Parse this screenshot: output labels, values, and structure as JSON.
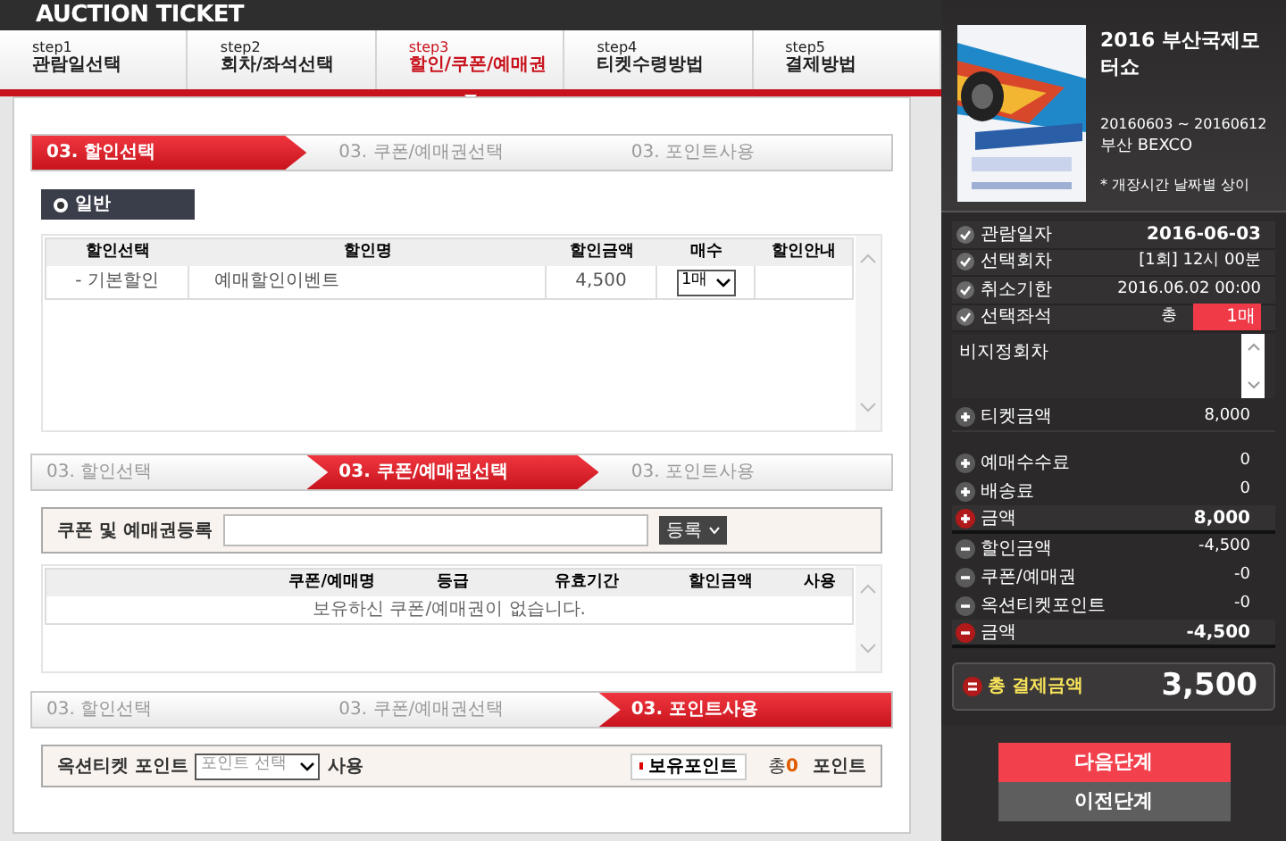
{
  "header": {
    "title": "AUCTION TICKET"
  },
  "steps": [
    {
      "step": "step1",
      "label": "관람일선택",
      "selected": false
    },
    {
      "step": "step2",
      "label": "회차/좌석선택",
      "selected": false
    },
    {
      "step": "step3",
      "label": "할인/쿠폰/예매권",
      "selected": true
    },
    {
      "step": "step4",
      "label": "티켓수령방법",
      "selected": false
    },
    {
      "step": "step5",
      "label": "결제방법",
      "selected": false
    }
  ],
  "discount_section": {
    "tabs": [
      {
        "label": "03. 할인선택",
        "selected": true
      },
      {
        "label": "03. 쿠폰/예매권선택",
        "selected": false
      },
      {
        "label": "03. 포인트사용",
        "selected": false
      }
    ],
    "radio": {
      "label": "일반",
      "selected": true
    },
    "table": {
      "columns": [
        "할인선택",
        "할인명",
        "할인금액",
        "매수",
        "할인안내"
      ],
      "rows": [
        {
          "type": "- 기본할인",
          "name": "예매할인이벤트",
          "amount": "4,500",
          "quantity": "1매"
        }
      ]
    }
  },
  "coupon_section": {
    "tabs": [
      {
        "label": "03. 할인선택",
        "selected": false
      },
      {
        "label": "03. 쿠폰/예매권선택",
        "selected": true
      },
      {
        "label": "03. 포인트사용",
        "selected": false
      }
    ],
    "field_label": "쿠폰 및 예매권등록",
    "register_button": "등록",
    "table": {
      "columns": [
        "쿠폰/예매명",
        "등급",
        "유효기간",
        "할인금액",
        "사용"
      ],
      "empty_message": "보유하신 쿠폰/예매권이 없습니다."
    }
  },
  "point_section": {
    "tabs": [
      {
        "label": "03. 할인선택",
        "selected": false
      },
      {
        "label": "03. 쿠폰/예매권선택",
        "selected": false
      },
      {
        "label": "03. 포인트사용",
        "selected": true
      }
    ],
    "label": "옥션티켓 포인트",
    "select_value": "포인트 선택",
    "suffix": "사용",
    "points_button": "보유포인트",
    "total_prefix": "총",
    "total_value": "0",
    "unit": "포인트"
  },
  "sidebar": {
    "event": {
      "title": "2016 부산국제모터쇼",
      "dates": "20160603 ~ 20160612",
      "venue": "부산 BEXCO",
      "note": "* 개장시간 날짜별 상이"
    },
    "info": [
      {
        "label": "관람일자",
        "value": "2016-06-03",
        "kind": "bold"
      },
      {
        "label": "선택회차",
        "value": "[1회] 12시 00분",
        "kind": "plain"
      },
      {
        "label": "취소기한",
        "value": "2016.06.02 00:00",
        "kind": "plain"
      },
      {
        "label": "선택좌석",
        "value": "총",
        "badge": "1매",
        "kind": "seat"
      }
    ],
    "seat_note": "비지정회차",
    "ticket": {
      "kind": "plus",
      "label": "티켓금액",
      "value": "8,000"
    },
    "amounts": [
      {
        "kind": "plus",
        "label": "예매수수료",
        "value": "0",
        "emphasis": false
      },
      {
        "kind": "plus",
        "label": "배송료",
        "value": "0",
        "emphasis": false
      },
      {
        "kind": "plus",
        "label": "금액",
        "value": "8,000",
        "emphasis": true
      },
      {
        "kind": "minus",
        "label": "할인금액",
        "value": "-4,500",
        "emphasis": false
      },
      {
        "kind": "minus",
        "label": "쿠폰/예매권",
        "value": "-0",
        "emphasis": false
      },
      {
        "kind": "minus",
        "label": "옥션티켓포인트",
        "value": "-0",
        "emphasis": false
      },
      {
        "kind": "minus",
        "label": "금액",
        "value": "-4,500",
        "emphasis": true
      }
    ],
    "total": {
      "label": "총 결제금액",
      "value": "3,500"
    },
    "next_button": "다음단계",
    "prev_button": "이전단계"
  }
}
